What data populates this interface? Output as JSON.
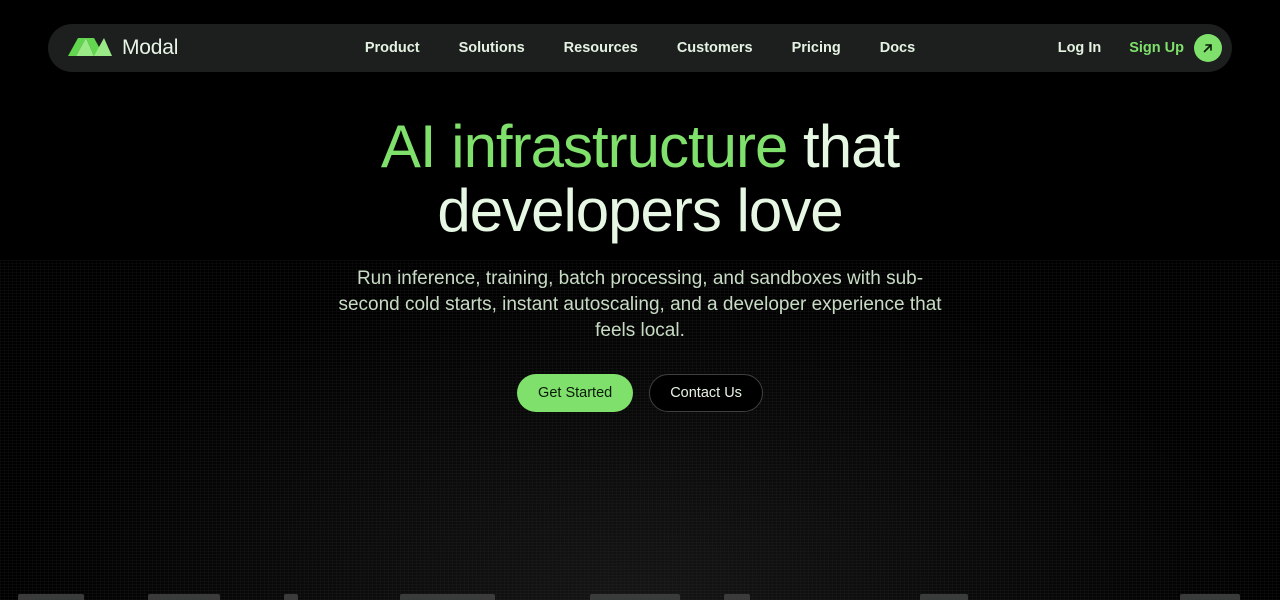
{
  "brand": {
    "name": "Modal",
    "accent_color": "#7fe06b",
    "logo_icon": "modal-logo-icon"
  },
  "nav": {
    "links": [
      {
        "label": "Product"
      },
      {
        "label": "Solutions"
      },
      {
        "label": "Resources"
      },
      {
        "label": "Customers"
      },
      {
        "label": "Pricing"
      },
      {
        "label": "Docs"
      }
    ],
    "login_label": "Log In",
    "signup_label": "Sign Up",
    "signup_icon": "arrow-up-right-icon"
  },
  "hero": {
    "title_accent": "AI infrastructure",
    "title_rest_line1": " that",
    "title_line2": "developers love",
    "subtitle": "Run inference, training, batch processing, and sandboxes with sub-second cold starts, instant autoscaling, and a developer experience that feels local.",
    "primary_cta": "Get Started",
    "secondary_cta": "Contact Us"
  }
}
